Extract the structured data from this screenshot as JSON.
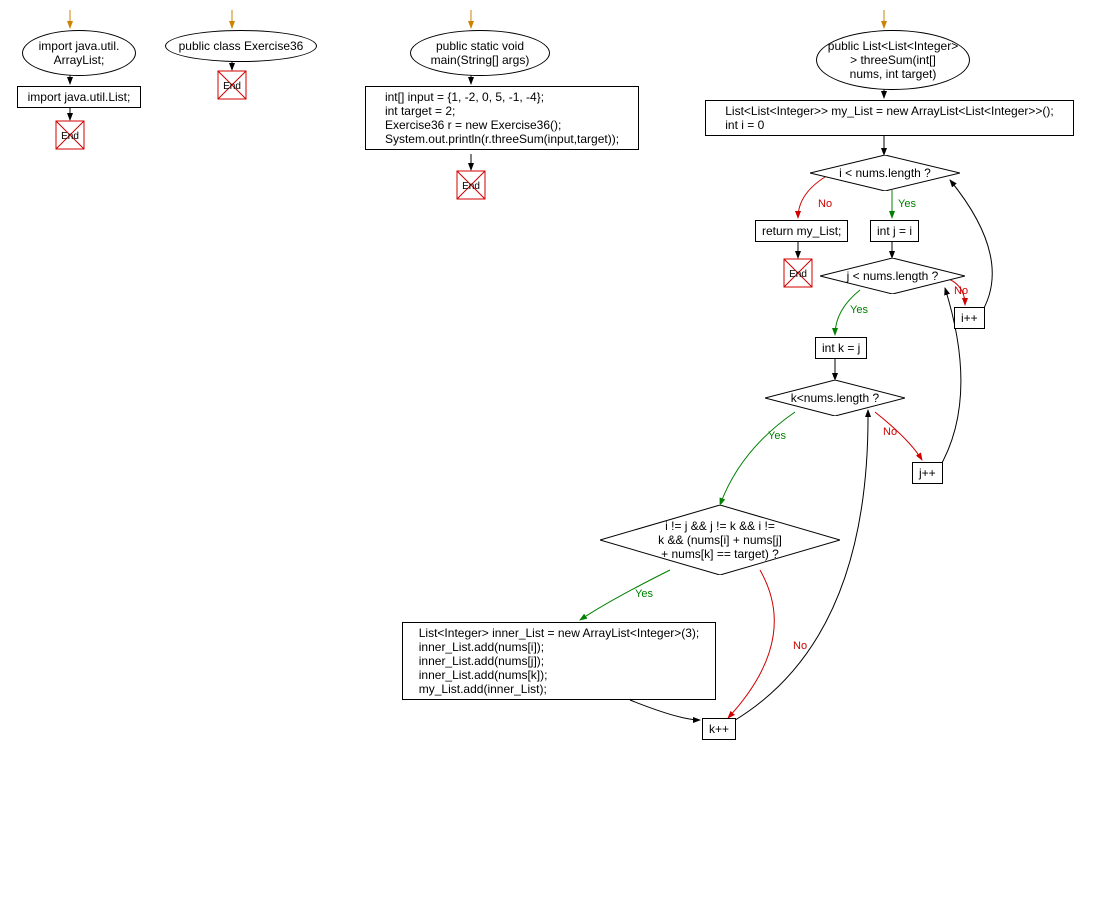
{
  "blocks": {
    "import1_ellipse": "import java.util.\nArrayList;",
    "import1_rect": "import java.util.List;",
    "class_ellipse": "public class Exercise36",
    "main_ellipse": "public static void\nmain(String[] args)",
    "main_rect": "int[] input = {1, -2, 0, 5, -1, -4};\nint target = 2;\nExercise36 r = new Exercise36();\nSystem.out.println(r.threeSum(input,target));",
    "threesum_ellipse": "public List<List<Integer>\n> threeSum(int[]\nnums, int target)",
    "threesum_init": "List<List<Integer>> my_List = new ArrayList<List<Integer>>();\nint i = 0",
    "cond_i": "i < nums.length ?",
    "return_mylist": "return my_List;",
    "init_j": "int j = i",
    "cond_j": "j < nums.length ?",
    "init_k": "int k = j",
    "inc_i": "i++",
    "cond_k": "k<nums.length ?",
    "inc_j": "j++",
    "cond_inner": "i != j && j != k && i !=\nk && (nums[i] + nums[j]\n+ nums[k] == target) ?",
    "inner_block": "List<Integer> inner_List = new ArrayList<Integer>(3);\ninner_List.add(nums[i]);\ninner_List.add(nums[j]);\ninner_List.add(nums[k]);\nmy_List.add(inner_List);",
    "inc_k": "k++",
    "end": "End",
    "yes": "Yes",
    "no": "No"
  }
}
